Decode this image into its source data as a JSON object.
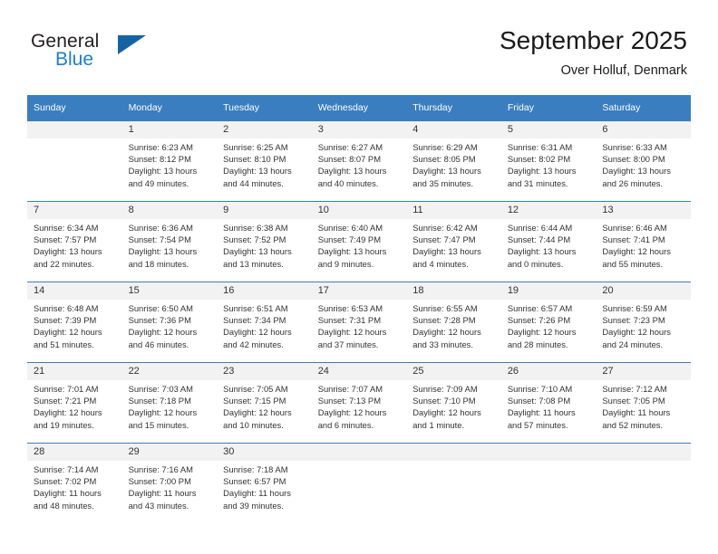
{
  "brand": {
    "name_part1": "General",
    "name_part2": "Blue",
    "logo_icon": "triangle-logo-icon",
    "accent_color": "#1a7fd4",
    "triangle_color": "#1464a5"
  },
  "header": {
    "title": "September 2025",
    "subtitle": "Over Holluf, Denmark"
  },
  "theme": {
    "header_row_color": "#3a7ec0",
    "daynum_band_color": "#f2f2f2",
    "text_color": "#333333"
  },
  "calendar": {
    "weekday_headers": [
      "Sunday",
      "Monday",
      "Tuesday",
      "Wednesday",
      "Thursday",
      "Friday",
      "Saturday"
    ],
    "labels": {
      "sunrise": "Sunrise:",
      "sunset": "Sunset:",
      "daylight": "Daylight:"
    },
    "weeks": [
      [
        {
          "day": "",
          "sunrise": "",
          "sunset": "",
          "daylight_line1": "",
          "daylight_line2": ""
        },
        {
          "day": "1",
          "sunrise": "Sunrise: 6:23 AM",
          "sunset": "Sunset: 8:12 PM",
          "daylight_line1": "Daylight: 13 hours",
          "daylight_line2": "and 49 minutes."
        },
        {
          "day": "2",
          "sunrise": "Sunrise: 6:25 AM",
          "sunset": "Sunset: 8:10 PM",
          "daylight_line1": "Daylight: 13 hours",
          "daylight_line2": "and 44 minutes."
        },
        {
          "day": "3",
          "sunrise": "Sunrise: 6:27 AM",
          "sunset": "Sunset: 8:07 PM",
          "daylight_line1": "Daylight: 13 hours",
          "daylight_line2": "and 40 minutes."
        },
        {
          "day": "4",
          "sunrise": "Sunrise: 6:29 AM",
          "sunset": "Sunset: 8:05 PM",
          "daylight_line1": "Daylight: 13 hours",
          "daylight_line2": "and 35 minutes."
        },
        {
          "day": "5",
          "sunrise": "Sunrise: 6:31 AM",
          "sunset": "Sunset: 8:02 PM",
          "daylight_line1": "Daylight: 13 hours",
          "daylight_line2": "and 31 minutes."
        },
        {
          "day": "6",
          "sunrise": "Sunrise: 6:33 AM",
          "sunset": "Sunset: 8:00 PM",
          "daylight_line1": "Daylight: 13 hours",
          "daylight_line2": "and 26 minutes."
        }
      ],
      [
        {
          "day": "7",
          "sunrise": "Sunrise: 6:34 AM",
          "sunset": "Sunset: 7:57 PM",
          "daylight_line1": "Daylight: 13 hours",
          "daylight_line2": "and 22 minutes."
        },
        {
          "day": "8",
          "sunrise": "Sunrise: 6:36 AM",
          "sunset": "Sunset: 7:54 PM",
          "daylight_line1": "Daylight: 13 hours",
          "daylight_line2": "and 18 minutes."
        },
        {
          "day": "9",
          "sunrise": "Sunrise: 6:38 AM",
          "sunset": "Sunset: 7:52 PM",
          "daylight_line1": "Daylight: 13 hours",
          "daylight_line2": "and 13 minutes."
        },
        {
          "day": "10",
          "sunrise": "Sunrise: 6:40 AM",
          "sunset": "Sunset: 7:49 PM",
          "daylight_line1": "Daylight: 13 hours",
          "daylight_line2": "and 9 minutes."
        },
        {
          "day": "11",
          "sunrise": "Sunrise: 6:42 AM",
          "sunset": "Sunset: 7:47 PM",
          "daylight_line1": "Daylight: 13 hours",
          "daylight_line2": "and 4 minutes."
        },
        {
          "day": "12",
          "sunrise": "Sunrise: 6:44 AM",
          "sunset": "Sunset: 7:44 PM",
          "daylight_line1": "Daylight: 13 hours",
          "daylight_line2": "and 0 minutes."
        },
        {
          "day": "13",
          "sunrise": "Sunrise: 6:46 AM",
          "sunset": "Sunset: 7:41 PM",
          "daylight_line1": "Daylight: 12 hours",
          "daylight_line2": "and 55 minutes."
        }
      ],
      [
        {
          "day": "14",
          "sunrise": "Sunrise: 6:48 AM",
          "sunset": "Sunset: 7:39 PM",
          "daylight_line1": "Daylight: 12 hours",
          "daylight_line2": "and 51 minutes."
        },
        {
          "day": "15",
          "sunrise": "Sunrise: 6:50 AM",
          "sunset": "Sunset: 7:36 PM",
          "daylight_line1": "Daylight: 12 hours",
          "daylight_line2": "and 46 minutes."
        },
        {
          "day": "16",
          "sunrise": "Sunrise: 6:51 AM",
          "sunset": "Sunset: 7:34 PM",
          "daylight_line1": "Daylight: 12 hours",
          "daylight_line2": "and 42 minutes."
        },
        {
          "day": "17",
          "sunrise": "Sunrise: 6:53 AM",
          "sunset": "Sunset: 7:31 PM",
          "daylight_line1": "Daylight: 12 hours",
          "daylight_line2": "and 37 minutes."
        },
        {
          "day": "18",
          "sunrise": "Sunrise: 6:55 AM",
          "sunset": "Sunset: 7:28 PM",
          "daylight_line1": "Daylight: 12 hours",
          "daylight_line2": "and 33 minutes."
        },
        {
          "day": "19",
          "sunrise": "Sunrise: 6:57 AM",
          "sunset": "Sunset: 7:26 PM",
          "daylight_line1": "Daylight: 12 hours",
          "daylight_line2": "and 28 minutes."
        },
        {
          "day": "20",
          "sunrise": "Sunrise: 6:59 AM",
          "sunset": "Sunset: 7:23 PM",
          "daylight_line1": "Daylight: 12 hours",
          "daylight_line2": "and 24 minutes."
        }
      ],
      [
        {
          "day": "21",
          "sunrise": "Sunrise: 7:01 AM",
          "sunset": "Sunset: 7:21 PM",
          "daylight_line1": "Daylight: 12 hours",
          "daylight_line2": "and 19 minutes."
        },
        {
          "day": "22",
          "sunrise": "Sunrise: 7:03 AM",
          "sunset": "Sunset: 7:18 PM",
          "daylight_line1": "Daylight: 12 hours",
          "daylight_line2": "and 15 minutes."
        },
        {
          "day": "23",
          "sunrise": "Sunrise: 7:05 AM",
          "sunset": "Sunset: 7:15 PM",
          "daylight_line1": "Daylight: 12 hours",
          "daylight_line2": "and 10 minutes."
        },
        {
          "day": "24",
          "sunrise": "Sunrise: 7:07 AM",
          "sunset": "Sunset: 7:13 PM",
          "daylight_line1": "Daylight: 12 hours",
          "daylight_line2": "and 6 minutes."
        },
        {
          "day": "25",
          "sunrise": "Sunrise: 7:09 AM",
          "sunset": "Sunset: 7:10 PM",
          "daylight_line1": "Daylight: 12 hours",
          "daylight_line2": "and 1 minute."
        },
        {
          "day": "26",
          "sunrise": "Sunrise: 7:10 AM",
          "sunset": "Sunset: 7:08 PM",
          "daylight_line1": "Daylight: 11 hours",
          "daylight_line2": "and 57 minutes."
        },
        {
          "day": "27",
          "sunrise": "Sunrise: 7:12 AM",
          "sunset": "Sunset: 7:05 PM",
          "daylight_line1": "Daylight: 11 hours",
          "daylight_line2": "and 52 minutes."
        }
      ],
      [
        {
          "day": "28",
          "sunrise": "Sunrise: 7:14 AM",
          "sunset": "Sunset: 7:02 PM",
          "daylight_line1": "Daylight: 11 hours",
          "daylight_line2": "and 48 minutes."
        },
        {
          "day": "29",
          "sunrise": "Sunrise: 7:16 AM",
          "sunset": "Sunset: 7:00 PM",
          "daylight_line1": "Daylight: 11 hours",
          "daylight_line2": "and 43 minutes."
        },
        {
          "day": "30",
          "sunrise": "Sunrise: 7:18 AM",
          "sunset": "Sunset: 6:57 PM",
          "daylight_line1": "Daylight: 11 hours",
          "daylight_line2": "and 39 minutes."
        },
        {
          "day": "",
          "sunrise": "",
          "sunset": "",
          "daylight_line1": "",
          "daylight_line2": ""
        },
        {
          "day": "",
          "sunrise": "",
          "sunset": "",
          "daylight_line1": "",
          "daylight_line2": ""
        },
        {
          "day": "",
          "sunrise": "",
          "sunset": "",
          "daylight_line1": "",
          "daylight_line2": ""
        },
        {
          "day": "",
          "sunrise": "",
          "sunset": "",
          "daylight_line1": "",
          "daylight_line2": ""
        }
      ]
    ]
  }
}
